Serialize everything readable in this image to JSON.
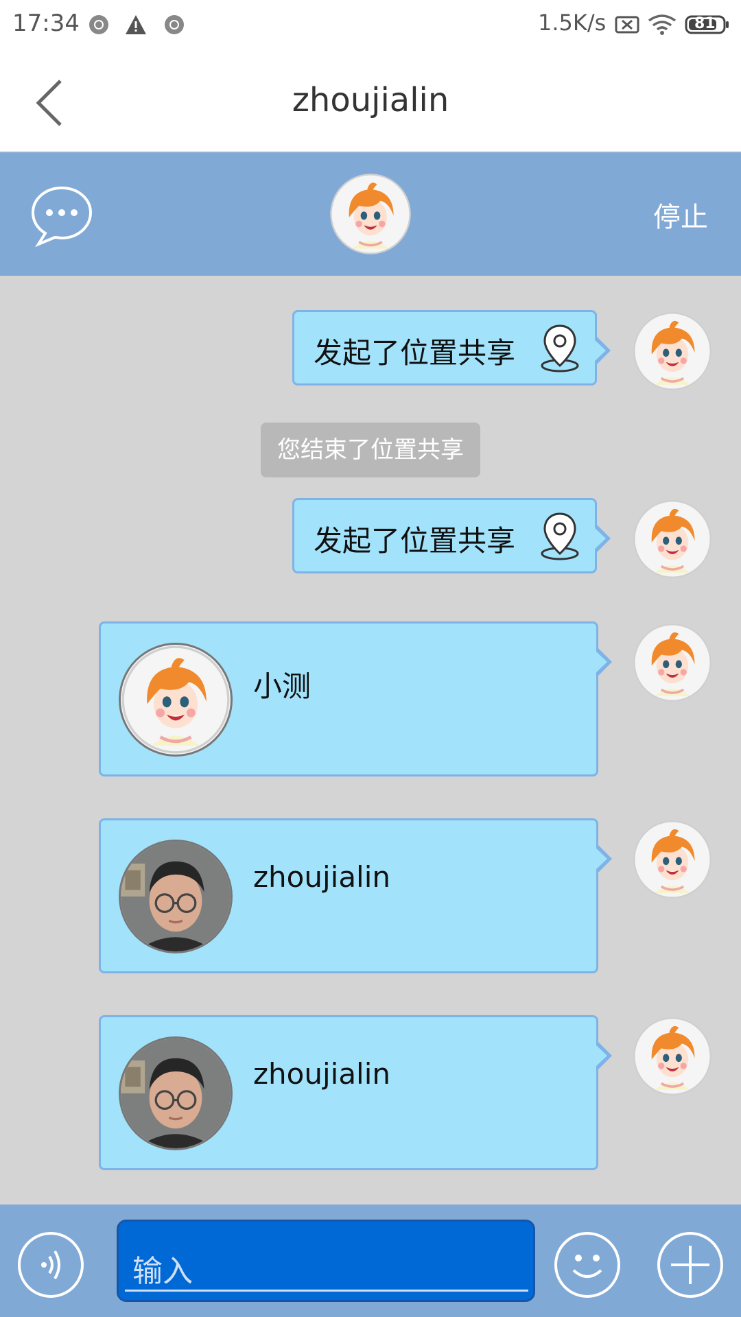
{
  "status_bar": {
    "time": "17:34",
    "net_speed": "1.5K/s",
    "battery": "81",
    "icons": [
      "notification-icon",
      "warning-icon",
      "notification-icon",
      "no-sim-icon",
      "wifi-icon",
      "battery-icon"
    ]
  },
  "header": {
    "title": "zhoujialin",
    "back_icon": "chevron-left-icon"
  },
  "share_bar": {
    "chat_icon": "chat-bubble-icon",
    "stop_label": "停止"
  },
  "messages": [
    {
      "type": "location",
      "text": "发起了位置共享",
      "icon": "location-pin-icon"
    },
    {
      "type": "system",
      "text": "您结束了位置共享"
    },
    {
      "type": "location",
      "text": "发起了位置共享",
      "icon": "location-pin-icon"
    },
    {
      "type": "contact_card",
      "name": "小测",
      "photo": "cartoon-girl-avatar"
    },
    {
      "type": "contact_card",
      "name": "zhoujialin",
      "photo": "man-photo-avatar"
    },
    {
      "type": "contact_card",
      "name": "zhoujialin",
      "photo": "man-photo-avatar"
    }
  ],
  "input_bar": {
    "placeholder": "输入",
    "value": "",
    "icons": [
      "voice-icon",
      "emoji-icon",
      "plus-icon"
    ]
  },
  "colors": {
    "bar_blue": "#80a9d6",
    "bubble_fill": "#a2e3fb",
    "bubble_border": "#7db3e6",
    "input_blue": "#0069d6",
    "chat_background": "#d4d4d4"
  }
}
